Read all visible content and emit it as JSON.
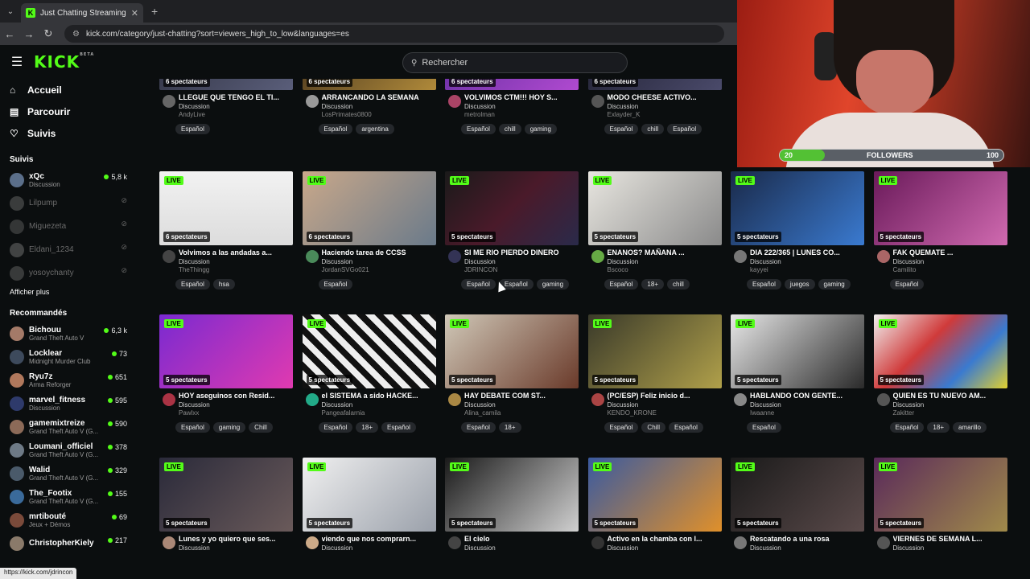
{
  "browser": {
    "tab_title": "Just Chatting Streaming - Live S",
    "favicon_letter": "K",
    "url": "kick.com/category/just-chatting?sort=viewers_high_to_low&languages=es"
  },
  "header": {
    "logo": "KICK",
    "logo_sup": "BETA",
    "search_placeholder": "Rechercher"
  },
  "sidebar": {
    "nav": [
      {
        "label": "Accueil",
        "icon": "home-icon",
        "glyph": "⌂"
      },
      {
        "label": "Parcourir",
        "icon": "browse-icon",
        "glyph": "▤"
      },
      {
        "label": "Suivis",
        "icon": "heart-icon",
        "glyph": "♡"
      }
    ],
    "followed_title": "Suivis",
    "followed": [
      {
        "name": "xQc",
        "category": "Discussion",
        "viewers": "5,8 k",
        "live": true,
        "color": "#5b6f8a"
      },
      {
        "name": "Lilpump",
        "category": "",
        "viewers": "⊘",
        "live": false,
        "color": "#6a6a6a"
      },
      {
        "name": "Miguezeta",
        "category": "",
        "viewers": "⊘",
        "live": false,
        "color": "#5e5e5e"
      },
      {
        "name": "Eldani_1234",
        "category": "",
        "viewers": "⊘",
        "live": false,
        "color": "#777"
      },
      {
        "name": "yosoychanty",
        "category": "",
        "viewers": "⊘",
        "live": false,
        "color": "#666"
      }
    ],
    "show_more": "Afficher plus",
    "recommended_title": "Recommandés",
    "recommended": [
      {
        "name": "Bichouu",
        "category": "Grand Theft Auto V",
        "viewers": "6,3 k",
        "color": "#a47a68"
      },
      {
        "name": "Locklear",
        "category": "Midnight Murder Club",
        "viewers": "73",
        "color": "#3d4a5c"
      },
      {
        "name": "Ryu7z",
        "category": "Arma Reforger",
        "viewers": "651",
        "color": "#b0785c"
      },
      {
        "name": "marvel_fitness",
        "category": "Discussion",
        "viewers": "595",
        "color": "#2e3a6b"
      },
      {
        "name": "gamemixtreize",
        "category": "Grand Theft Auto V (G...",
        "viewers": "590",
        "color": "#8c6a58"
      },
      {
        "name": "Loumani_officiel",
        "category": "Grand Theft Auto V (G...",
        "viewers": "378",
        "color": "#6e7a86"
      },
      {
        "name": "Walid",
        "category": "Grand Theft Auto V (G...",
        "viewers": "329",
        "color": "#4a5a6a"
      },
      {
        "name": "The_Footix",
        "category": "Grand Theft Auto V (G...",
        "viewers": "155",
        "color": "#3a6a9a"
      },
      {
        "name": "mrtibouté",
        "category": "Jeux + Démos",
        "viewers": "69",
        "color": "#7a4a3a"
      },
      {
        "name": "ChristopherKiely",
        "category": "",
        "viewers": "217",
        "color": "#8a7a6a"
      }
    ]
  },
  "streams": [
    {
      "title": "LLEGUE QUE TENGO EL TI...",
      "category": "Discussion",
      "streamer": "AndyLive",
      "viewers": "6 spectateurs",
      "tags": [
        "Español"
      ],
      "live": false,
      "bg": "linear-gradient(135deg,#2a2c3a,#5a5e7a)",
      "av": "#666"
    },
    {
      "title": "ARRANCANDO LA SEMANA",
      "category": "Discussion",
      "streamer": "LosPrimates0800",
      "viewers": "6 spectateurs",
      "tags": [
        "Español",
        "argentina"
      ],
      "live": false,
      "bg": "linear-gradient(135deg,#3a2a1a,#b08a3a)",
      "av": "#999"
    },
    {
      "title": "VOLVIMOS CTM!!! HOY S...",
      "category": "Discussion",
      "streamer": "metrolman",
      "viewers": "6 spectateurs",
      "tags": [
        "Español",
        "chill",
        "gaming"
      ],
      "live": false,
      "bg": "linear-gradient(135deg,#5a2a9a,#b04ad0)",
      "av": "#a46"
    },
    {
      "title": "MODO CHEESE ACTIVO...",
      "category": "Discussion",
      "streamer": "Exlayder_K",
      "viewers": "6 spectateurs",
      "tags": [
        "Español",
        "chill",
        "Español"
      ],
      "live": false,
      "bg": "linear-gradient(135deg,#1a1a2a,#4a4a6a)",
      "av": "#555"
    },
    {
      "title": "Volvimos a las andadas a...",
      "category": "Discussion",
      "streamer": "TheThingg",
      "viewers": "6 spectateurs",
      "tags": [
        "Español",
        "hsa"
      ],
      "live": true,
      "bg": "linear-gradient(180deg,#f2f2f2,#dcdcdc)",
      "av": "#444"
    },
    {
      "title": "Haciendo tarea de CCSS",
      "category": "Discussion",
      "streamer": "JordanSVGo021",
      "viewers": "6 spectateurs",
      "tags": [
        "Español"
      ],
      "live": true,
      "bg": "linear-gradient(135deg,#c9a88a,#6a7a8a)",
      "av": "#4a8a5a"
    },
    {
      "title": "SI ME RIO PIERDO DINERO",
      "category": "Discussion",
      "streamer": "JDRINCON",
      "viewers": "5 spectateurs",
      "tags": [
        "Español",
        "Español",
        "gaming"
      ],
      "live": true,
      "bg": "linear-gradient(135deg,#1a1a1a,#4a1a2a 50%,#2a2a4a)",
      "av": "#335"
    },
    {
      "title": "ENANOS? MAÑANA ...",
      "category": "Discussion",
      "streamer": "Bscoco",
      "viewers": "5 spectateurs",
      "tags": [
        "Español",
        "18+",
        "chill"
      ],
      "live": true,
      "bg": "linear-gradient(135deg,#e8e6e0,#8a8a8a)",
      "av": "#6a4"
    },
    {
      "title": "DIA 222/365 | LUNES CO...",
      "category": "Discussion",
      "streamer": "kayyei",
      "viewers": "5 spectateurs",
      "tags": [
        "Español",
        "juegos",
        "gaming"
      ],
      "live": true,
      "bg": "linear-gradient(135deg,#1a2a4a,#3a7ad0)",
      "av": "#777"
    },
    {
      "title": "FAK QUEMATE ...",
      "category": "Discussion",
      "streamer": "Camilito",
      "viewers": "5 spectateurs",
      "tags": [
        "Español"
      ],
      "live": true,
      "bg": "linear-gradient(135deg,#6a1a5a,#d06ab0)",
      "av": "#a66"
    },
    {
      "title": "HOY aseguinos con Resid...",
      "category": "Discussion",
      "streamer": "Pawlxx",
      "viewers": "5 spectateurs",
      "tags": [
        "Español",
        "gaming",
        "Chill"
      ],
      "live": true,
      "bg": "linear-gradient(135deg,#7a2ad0,#e03ab0)",
      "av": "#a34"
    },
    {
      "title": "el SISTEMA a sido HACKE...",
      "category": "Discussion",
      "streamer": "Pangeafalarnia",
      "viewers": "5 spectateurs",
      "tags": [
        "Español",
        "18+",
        "Español"
      ],
      "live": true,
      "bg": "repeating-linear-gradient(45deg,#111 0 8px,#eee 8px 16px)",
      "av": "#2a8"
    },
    {
      "title": "HAY DEBATE COM ST...",
      "category": "Discussion",
      "streamer": "Alina_camila",
      "viewers": "5 spectateurs",
      "tags": [
        "Español",
        "18+"
      ],
      "live": true,
      "bg": "linear-gradient(135deg,#d0c8b8,#6a3a2a)",
      "av": "#a84"
    },
    {
      "title": "(PC/ESP) Feliz inicio d...",
      "category": "Discussion",
      "streamer": "KENDO_KRONE",
      "viewers": "5 spectateurs",
      "tags": [
        "Español",
        "Chill",
        "Español"
      ],
      "live": true,
      "bg": "linear-gradient(135deg,#3a3a2a,#b0a04a)",
      "av": "#a44"
    },
    {
      "title": "HABLANDO CON GENTE...",
      "category": "Discussion",
      "streamer": "Iwaanne",
      "viewers": "5 spectateurs",
      "tags": [
        "Español"
      ],
      "live": true,
      "bg": "linear-gradient(135deg,#e8e8e8,#2a2a2a)",
      "av": "#888"
    },
    {
      "title": "QUIEN ES TU NUEVO AM...",
      "category": "Discussion",
      "streamer": "Zakitter",
      "viewers": "5 spectateurs",
      "tags": [
        "Español",
        "18+",
        "amarillo"
      ],
      "live": true,
      "bg": "linear-gradient(135deg,#f0f0f0,#d03a3a 40%,#3a7ad0 70%,#e0d030)",
      "av": "#555"
    },
    {
      "title": "Lunes y yo quiero que ses...",
      "category": "Discussion",
      "streamer": "",
      "viewers": "5 spectateurs",
      "tags": [],
      "live": true,
      "bg": "linear-gradient(135deg,#2a2a3a,#6a5a5a)",
      "av": "#a87"
    },
    {
      "title": "viendo que nos comprarn...",
      "category": "Discussion",
      "streamer": "",
      "viewers": "5 spectateurs",
      "tags": [],
      "live": true,
      "bg": "linear-gradient(135deg,#f0f0f0,#9aa0aa)",
      "av": "#ca8"
    },
    {
      "title": "El cielo",
      "category": "Discussion",
      "streamer": "",
      "viewers": "5 spectateurs",
      "tags": [],
      "live": true,
      "bg": "linear-gradient(135deg,#1a1a1a,#d0d0d0)",
      "av": "#444"
    },
    {
      "title": "Activo en la chamba con l...",
      "category": "Discussion",
      "streamer": "",
      "viewers": "5 spectateurs",
      "tags": [],
      "live": true,
      "bg": "linear-gradient(135deg,#3a5aa0,#e0902a)",
      "av": "#333"
    },
    {
      "title": "Rescatando a una rosa",
      "category": "Discussion",
      "streamer": "",
      "viewers": "5 spectateurs",
      "tags": [],
      "live": true,
      "bg": "linear-gradient(135deg,#1a1a1a,#5a4a4a)",
      "av": "#777"
    },
    {
      "title": "VIERNES DE SEMANA L...",
      "category": "Discussion",
      "streamer": "",
      "viewers": "5 spectateurs",
      "tags": [],
      "live": true,
      "bg": "linear-gradient(135deg,#5a2a5a,#a08a4a)",
      "av": "#555"
    }
  ],
  "overlay": {
    "followers_label": "FOLLOWERS",
    "current": "20",
    "goal": "100",
    "progress_percent": 20
  },
  "status_url": "https://kick.com/jdrincon"
}
